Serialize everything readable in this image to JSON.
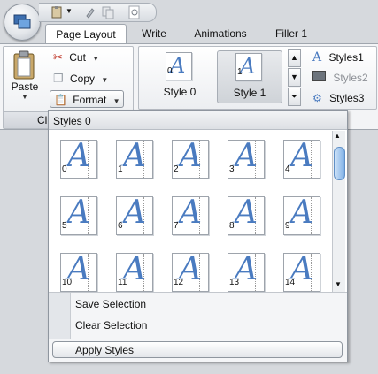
{
  "tabs": [
    {
      "label": "Page Layout",
      "selected": true
    },
    {
      "label": "Write",
      "selected": false
    },
    {
      "label": "Animations",
      "selected": false
    },
    {
      "label": "Filler 1",
      "selected": false
    }
  ],
  "clipboard": {
    "paste_label": "Paste",
    "cut_label": "Cut",
    "copy_label": "Copy",
    "format_label": "Format",
    "group_label": "Cl"
  },
  "styles_group": {
    "tiles": [
      {
        "num": "0",
        "label": "Style 0"
      },
      {
        "num": "1",
        "label": "Style 1"
      }
    ],
    "side_items": [
      "Styles1",
      "Styles2",
      "Styles3"
    ]
  },
  "popup": {
    "header": "Styles 0",
    "gallery_items": [
      "0",
      "1",
      "2",
      "3",
      "4",
      "5",
      "6",
      "7",
      "8",
      "9",
      "10",
      "11",
      "12",
      "13",
      "14"
    ],
    "menu": {
      "save_selection": "Save Selection",
      "clear_selection": "Clear Selection",
      "apply_styles": "Apply Styles"
    }
  },
  "colors": {
    "accent_blue": "#4a7bc0",
    "ribbon_bg": "#f3f4f6"
  }
}
